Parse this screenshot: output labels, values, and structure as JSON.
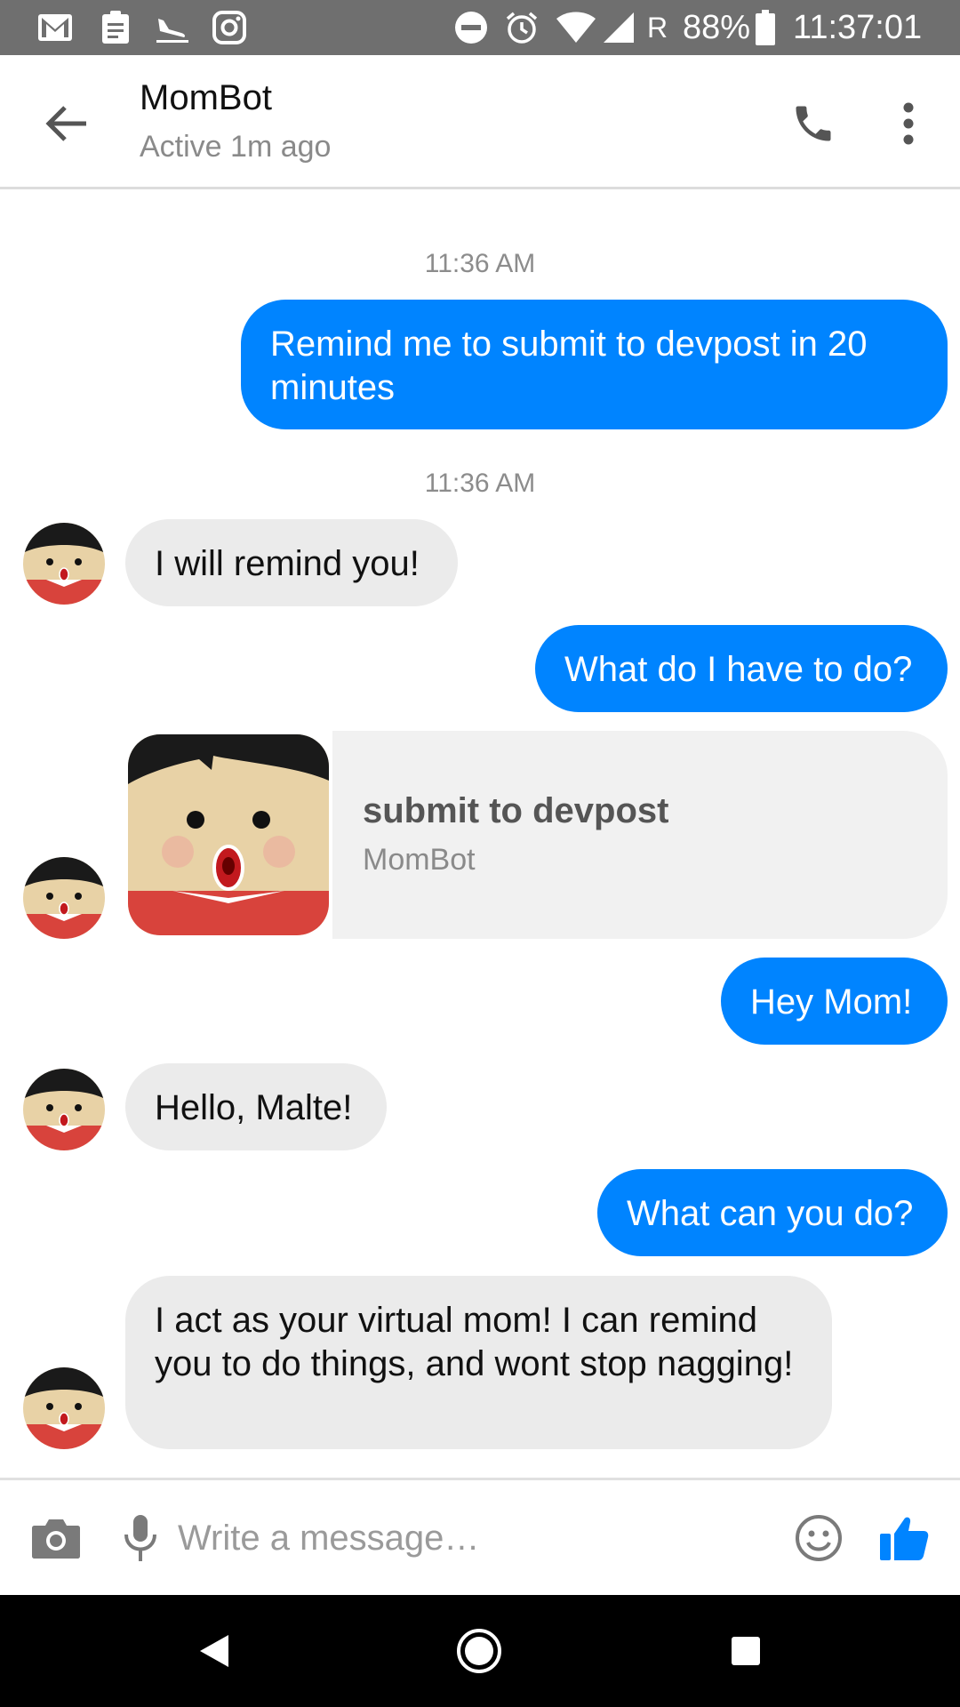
{
  "status_bar": {
    "left_icons": [
      "gmail-icon",
      "clipboard-icon",
      "airplane-arrival-icon",
      "instagram-icon"
    ],
    "right_icons": [
      "do-not-disturb-icon",
      "alarm-icon",
      "wifi-icon",
      "signal-icon"
    ],
    "roaming": "R",
    "battery_percent": "88%",
    "time": "11:37:01"
  },
  "header": {
    "title": "MomBot",
    "subtitle": "Active 1m ago"
  },
  "conversation": {
    "timestamp_1": "11:36 AM",
    "msg_1": "Remind me to submit to devpost in 20 minutes",
    "timestamp_2": "11:36 AM",
    "msg_2": "I will remind you!",
    "msg_3": "What do I have to do?",
    "card": {
      "title": "submit to devpost",
      "subtitle": "MomBot"
    },
    "msg_4": "Hey Mom!",
    "msg_5": "Hello, Malte!",
    "msg_6": "What can you do?",
    "msg_7": "I act as your virtual mom! I can remind you to do things, and wont stop nagging!"
  },
  "composer": {
    "placeholder": "Write a message…"
  },
  "colors": {
    "accent": "#0084ff",
    "incoming_bubble": "#ebebeb",
    "status_bar": "#6f6f6f"
  }
}
